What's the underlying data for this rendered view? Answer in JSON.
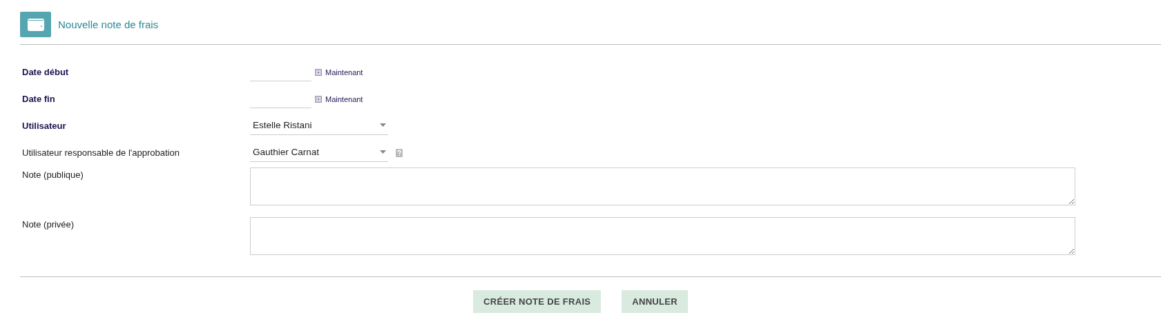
{
  "header": {
    "title": "Nouvelle note de frais"
  },
  "fields": [
    {
      "label": "Date début",
      "required": true,
      "kind": "date",
      "now_link": "Maintenant"
    },
    {
      "label": "Date fin",
      "required": true,
      "kind": "date",
      "now_link": "Maintenant"
    },
    {
      "label": "Utilisateur",
      "required": true,
      "kind": "select",
      "value": "Estelle Ristani",
      "help": false
    },
    {
      "label": "Utilisateur responsable de l'approbation",
      "required": false,
      "kind": "select",
      "value": "Gauthier Carnat",
      "help": true
    },
    {
      "label": "Note (publique)",
      "required": false,
      "kind": "textarea"
    },
    {
      "label": "Note (privée)",
      "required": false,
      "kind": "textarea"
    }
  ],
  "buttons": [
    "CRÉER NOTE DE FRAIS",
    "ANNULER"
  ]
}
